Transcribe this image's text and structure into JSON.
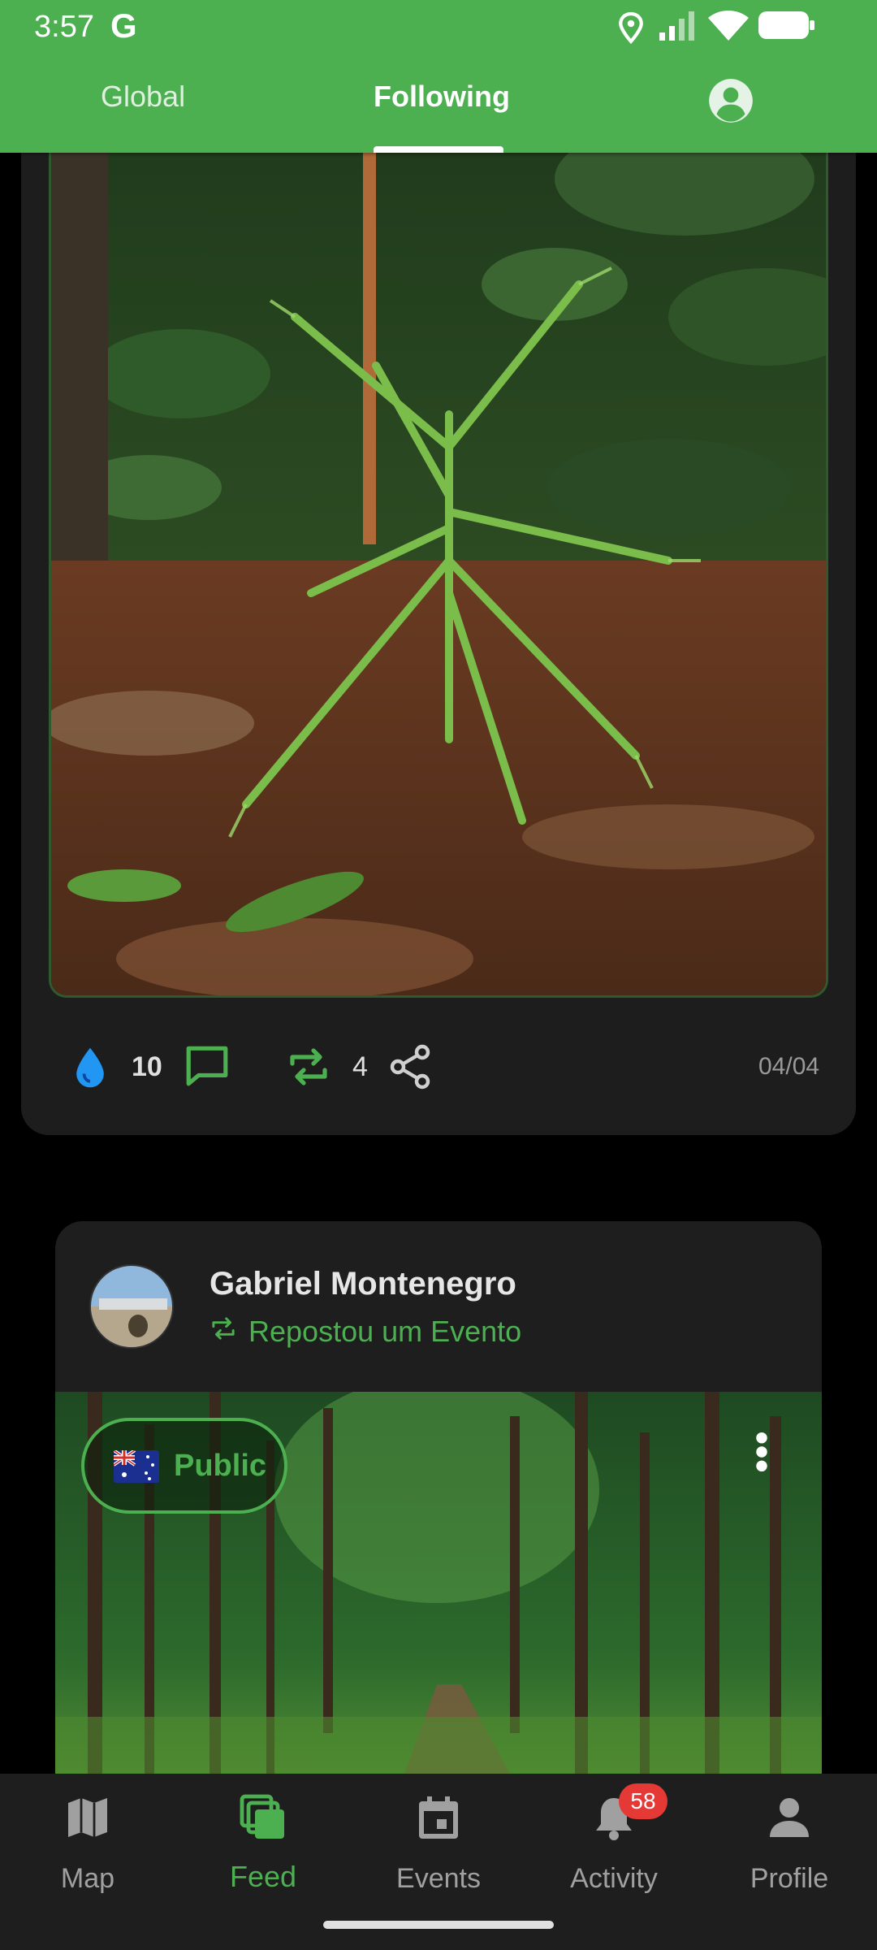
{
  "status_bar": {
    "time": "3:57",
    "g_logo": "G"
  },
  "tabs": [
    {
      "label": "Global"
    },
    {
      "label": "Following"
    }
  ],
  "post1": {
    "likes": "10",
    "reposts": "4",
    "date": "04/04"
  },
  "post2": {
    "author": "Gabriel Montenegro",
    "subtitle": "Repostou um Evento",
    "visibility": "Public"
  },
  "nav": {
    "map": "Map",
    "feed": "Feed",
    "events": "Events",
    "activity": "Activity",
    "activity_badge": "58",
    "profile": "Profile"
  },
  "colors": {
    "accent": "#4caf50",
    "badge": "#e53935",
    "like": "#2196f3"
  }
}
